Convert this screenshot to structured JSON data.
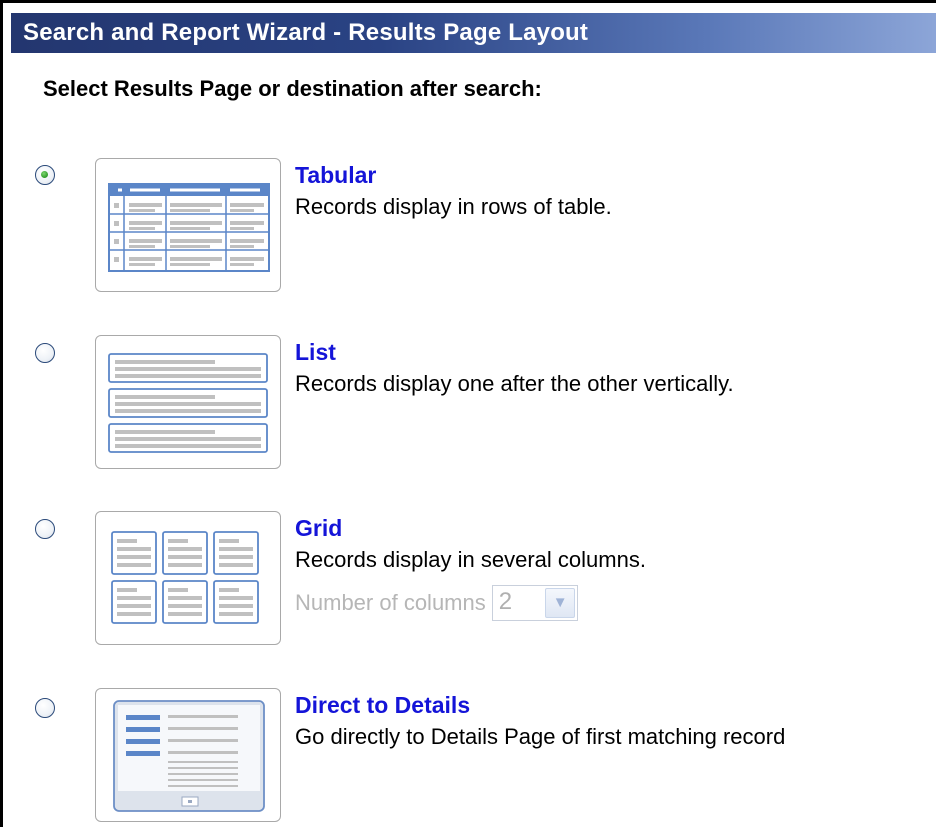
{
  "title": "Search and Report Wizard - Results Page Layout",
  "heading": "Select Results Page or destination after search:",
  "options": [
    {
      "title": "Tabular",
      "description": "Records display in rows of table.",
      "selected": true,
      "icon": "table-layout-icon"
    },
    {
      "title": "List",
      "description": "Records display one after the other vertically.",
      "selected": false,
      "icon": "list-layout-icon"
    },
    {
      "title": "Grid",
      "description": "Records display in several columns.",
      "selected": false,
      "icon": "grid-layout-icon"
    },
    {
      "title": "Direct to Details",
      "description": "Go directly to Details Page of first matching record",
      "selected": false,
      "icon": "details-layout-icon"
    }
  ],
  "grid_columns": {
    "label": "Number of columns",
    "value": "2",
    "enabled": false
  },
  "colors": {
    "title_bar": "#2a4384",
    "link": "#1414d8",
    "thumb_accent": "#5b86c8",
    "disabled_text": "#b6b6b6"
  }
}
